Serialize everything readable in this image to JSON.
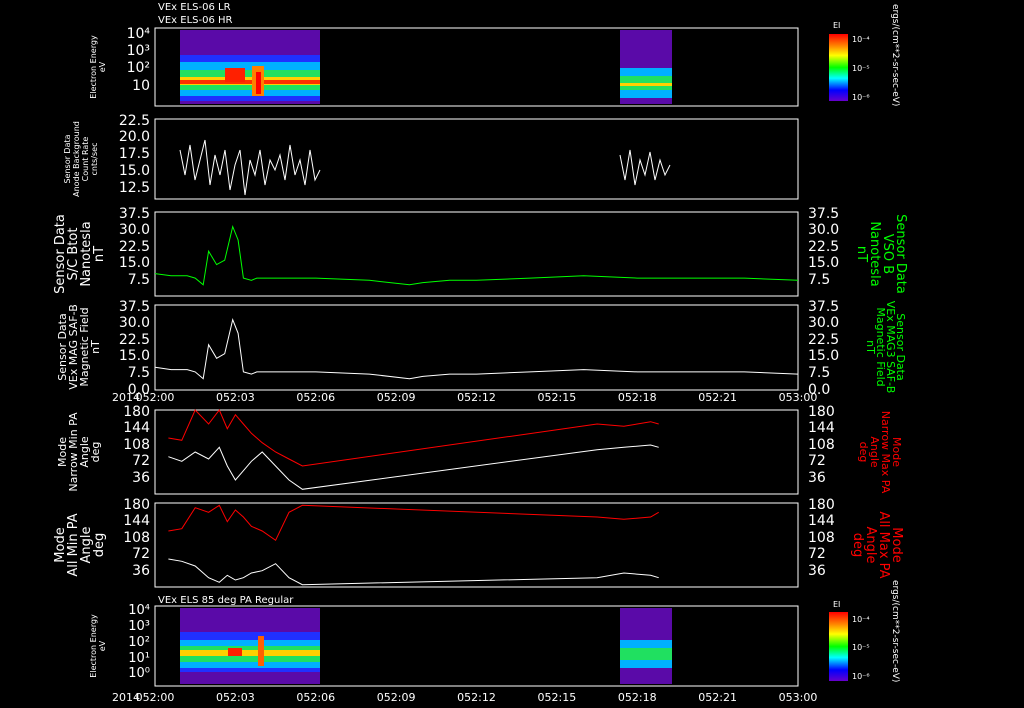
{
  "headers": {
    "top_line1": "VEx ELS-06 LR",
    "top_line2": "VEx ELS-06 HR",
    "bottom": "VEx ELS 85 deg PA Regular"
  },
  "colorbar": {
    "label": "EI",
    "ticks": [
      "10⁻⁴",
      "10⁻⁵",
      "10⁻⁶"
    ],
    "units": "ergs/(cm**2-sr-sec-eV)",
    "colors": [
      "#ff0000",
      "#ff8800",
      "#ffff00",
      "#00ff00",
      "#00ffff",
      "#0000ff",
      "#6600cc"
    ]
  },
  "x_axis": {
    "year_label": "2014",
    "ticks": [
      "052:00",
      "052:03",
      "052:06",
      "052:09",
      "052:12",
      "052:15",
      "052:18",
      "052:21",
      "053:00"
    ]
  },
  "panels": {
    "p1": {
      "ylabel": [
        "Electron Energy",
        "eV"
      ],
      "ticks": [
        "10⁴",
        "10³",
        "10²",
        "10"
      ]
    },
    "p2": {
      "ylabel": [
        "Sensor Data",
        "Anode Background",
        "Count Rate",
        "cnts/sec"
      ],
      "ticks": [
        "22.5",
        "20.0",
        "17.5",
        "15.0",
        "12.5"
      ]
    },
    "p3": {
      "ylabel": [
        "Sensor Data",
        "S/C Btot",
        "Nanotesla",
        "nT"
      ],
      "ylabel_right": [
        "Sensor Data",
        "VSO B",
        "Nanotesla",
        "nT"
      ],
      "ticks": [
        "37.5",
        "30.0",
        "22.5",
        "15.0",
        "7.5"
      ]
    },
    "p4": {
      "ylabel": [
        "Sensor Data",
        "VEx MAG SAF-B",
        "Magnetic Field",
        "nT"
      ],
      "ylabel_right": [
        "Sensor Data",
        "VEx MAG3 SAF-B",
        "Magnetic Field",
        "nT"
      ],
      "ticks": [
        "37.5",
        "30.0",
        "22.5",
        "15.0",
        "7.5",
        "0.0"
      ]
    },
    "p5": {
      "ylabel": [
        "Mode",
        "Narrow Min PA",
        "Angle",
        "deg"
      ],
      "ylabel_right": [
        "Mode",
        "Narrow Max PA",
        "Angle",
        "deg"
      ],
      "ticks": [
        "180",
        "144",
        "108",
        "72",
        "36"
      ]
    },
    "p6": {
      "ylabel": [
        "Mode",
        "All Min PA",
        "Angle",
        "deg"
      ],
      "ylabel_right": [
        "Mode",
        "All Max PA",
        "Angle",
        "deg"
      ],
      "ticks": [
        "180",
        "144",
        "108",
        "72",
        "36"
      ]
    },
    "p7": {
      "ylabel": [
        "Electron Energy",
        "eV"
      ],
      "ticks": [
        "10⁴",
        "10³",
        "10²",
        "10¹",
        "10⁰"
      ]
    }
  },
  "chart_data": {
    "type": "line",
    "x_unit": "day-of-year 2014, hours after 052:00",
    "x_range": [
      0,
      24
    ],
    "series": [
      {
        "panel": "S/C Btot (nT)",
        "color": "#00ff00",
        "x": [
          0,
          0.6,
          1.2,
          1.5,
          1.8,
          2.0,
          2.3,
          2.6,
          2.9,
          3.1,
          3.3,
          3.6,
          3.8,
          4,
          6,
          8,
          9.5,
          10,
          11,
          12,
          14,
          16,
          18,
          20,
          22,
          24
        ],
        "y": [
          10,
          9,
          9,
          8,
          5,
          20,
          14,
          16,
          31,
          25,
          8,
          7,
          8,
          8,
          8,
          7,
          5,
          6,
          7,
          7,
          8,
          9,
          8,
          8,
          8,
          7
        ]
      },
      {
        "panel": "VEx MAG SAF-B (nT)",
        "color": "#ffffff",
        "x": [
          0,
          0.6,
          1.2,
          1.5,
          1.8,
          2.0,
          2.3,
          2.6,
          2.9,
          3.1,
          3.3,
          3.6,
          3.8,
          4,
          6,
          8,
          9.5,
          10,
          11,
          12,
          14,
          16,
          18,
          20,
          22,
          24
        ],
        "y": [
          10,
          9,
          9,
          8,
          5,
          20,
          14,
          16,
          31,
          25,
          8,
          7,
          8,
          8,
          8,
          7,
          5,
          6,
          7,
          7,
          8,
          9,
          8,
          8,
          8,
          7
        ]
      },
      {
        "panel": "Narrow Max PA (deg)",
        "color": "#ff0000",
        "x": [
          0.5,
          1.0,
          1.5,
          2.0,
          2.4,
          2.7,
          3.0,
          3.3,
          3.6,
          4.0,
          4.5,
          5.0,
          5.5,
          16.5,
          17.5,
          18.5,
          18.8
        ],
        "y": [
          120,
          115,
          180,
          150,
          180,
          140,
          170,
          150,
          130,
          110,
          90,
          75,
          60,
          150,
          145,
          155,
          150
        ]
      },
      {
        "panel": "Narrow Min PA (deg)",
        "color": "#ffffff",
        "x": [
          0.5,
          1.0,
          1.5,
          2.0,
          2.4,
          2.7,
          3.0,
          3.3,
          3.6,
          4.0,
          4.5,
          5.0,
          5.5,
          16.5,
          17.5,
          18.5,
          18.8
        ],
        "y": [
          80,
          70,
          90,
          75,
          100,
          60,
          30,
          50,
          70,
          90,
          60,
          30,
          10,
          95,
          100,
          105,
          100
        ]
      },
      {
        "panel": "All Max PA (deg)",
        "color": "#ff0000",
        "x": [
          0.5,
          1.0,
          1.5,
          2.0,
          2.4,
          2.7,
          3.0,
          3.3,
          3.6,
          4.0,
          4.5,
          5.0,
          5.5,
          16.5,
          17.5,
          18.5,
          18.8
        ],
        "y": [
          120,
          125,
          170,
          160,
          175,
          140,
          165,
          150,
          130,
          120,
          100,
          160,
          175,
          150,
          145,
          150,
          160
        ]
      },
      {
        "panel": "All Min PA (deg)",
        "color": "#ffffff",
        "x": [
          0.5,
          1.0,
          1.5,
          2.0,
          2.4,
          2.7,
          3.0,
          3.3,
          3.6,
          4.0,
          4.5,
          5.0,
          5.5,
          16.5,
          17.5,
          18.5,
          18.8
        ],
        "y": [
          60,
          55,
          45,
          20,
          10,
          25,
          15,
          20,
          30,
          35,
          50,
          20,
          5,
          20,
          30,
          25,
          20
        ]
      }
    ]
  }
}
